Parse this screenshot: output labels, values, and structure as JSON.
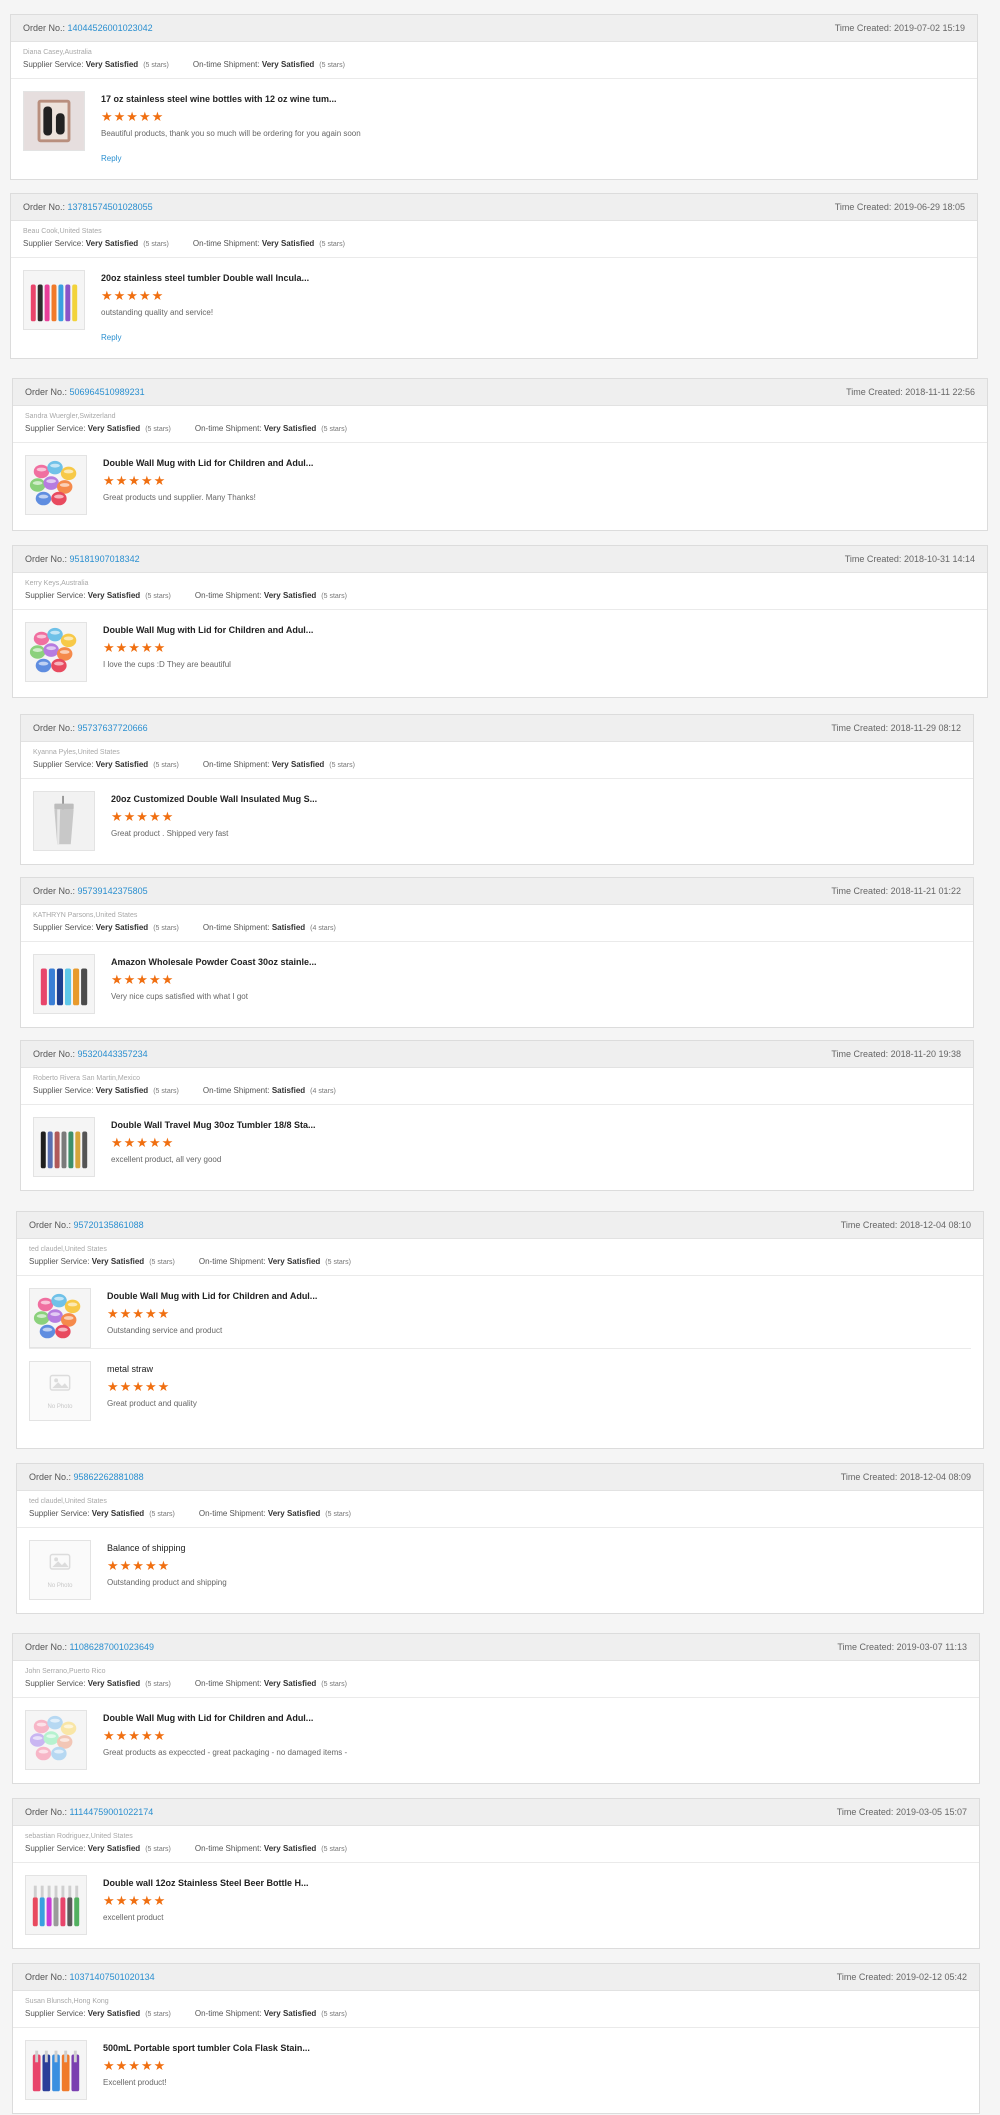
{
  "labels": {
    "order_no": "Order No.:",
    "time_created": "Time Created:",
    "supplier_service": "Supplier Service:",
    "on_time_shipment": "On-time Shipment:",
    "reply": "Reply",
    "no_photo": "No Photo"
  },
  "colors": {
    "link": "#2a8fd0",
    "star": "#f06f11",
    "header_bg": "#efefef"
  },
  "reviews": [
    {
      "order_no": "140445260010230​42",
      "time": "2019-07-02 15:19",
      "buyer": "Diana Casey,Australia",
      "supplier_rating": "Very Satisfied",
      "supplier_stars": "(5 stars)",
      "shipment_rating": "Very Satisfied",
      "shipment_stars": "(5 stars)",
      "items": [
        {
          "title": "17 oz stainless steel wine bottles with 12 oz wine tum...",
          "stars": "★★★★★",
          "comment": "Beautiful products, thank you so much will be ordering for you again soon",
          "image": "wine-bottle-set",
          "reply": "Reply"
        }
      ]
    },
    {
      "order_no": "137815745010280​55",
      "time": "2019-06-29 18:05",
      "buyer": "Beau Cook,United States",
      "supplier_rating": "Very Satisfied",
      "supplier_stars": "(5 stars)",
      "shipment_rating": "Very Satisfied",
      "shipment_stars": "(5 stars)",
      "items": [
        {
          "title": "20oz stainless steel tumbler Double wall Incula...",
          "stars": "★★★★★",
          "comment": "outstanding quality and service!",
          "image": "colored-tumblers",
          "reply": "Reply"
        }
      ]
    },
    {
      "order_no": "5069645109892​31",
      "time": "2018-11-11 22:56",
      "buyer": "Sandra Wuergler,Switzerland",
      "supplier_rating": "Very Satisfied",
      "supplier_stars": "(5 stars)",
      "shipment_rating": "Very Satisfied",
      "shipment_stars": "(5 stars)",
      "items": [
        {
          "title": "Double Wall Mug with Lid for Children and Adul...",
          "stars": "★★★★★",
          "comment": "Great products und supplier. Many Thanks!",
          "image": "colorful-mugs"
        }
      ]
    },
    {
      "order_no": "951819070183​42",
      "time": "2018-10-31 14:14",
      "buyer": "Kerry Keys,Australia",
      "supplier_rating": "Very Satisfied",
      "supplier_stars": "(5 stars)",
      "shipment_rating": "Very Satisfied",
      "shipment_stars": "(5 stars)",
      "items": [
        {
          "title": "Double Wall Mug with Lid for Children and Adul...",
          "stars": "★★★★★",
          "comment": "I love the cups :D They are beautiful",
          "image": "colorful-mugs"
        }
      ]
    },
    {
      "order_no": "957376377206​66",
      "time": "2018-11-29 08:12",
      "buyer": "Kyanna Pyles,United States",
      "supplier_rating": "Very Satisfied",
      "supplier_stars": "(5 stars)",
      "shipment_rating": "Very Satisfied",
      "shipment_stars": "(5 stars)",
      "items": [
        {
          "title": "20oz Customized Double Wall Insulated Mug S...",
          "stars": "★★★★★",
          "comment": "Great product . Shipped very fast",
          "image": "silver-tumbler"
        }
      ]
    },
    {
      "order_no": "957391423758​05",
      "time": "2018-11-21 01:22",
      "buyer": "KATHRYN Parsons,United States",
      "supplier_rating": "Very Satisfied",
      "supplier_stars": "(5 stars)",
      "shipment_rating": "Satisfied",
      "shipment_stars": "(4 stars)",
      "items": [
        {
          "title": "Amazon Wholesale Powder Coast 30oz stainle...",
          "stars": "★★★★★",
          "comment": "Very nice cups satisfied with what I got",
          "image": "powder-tumblers"
        }
      ]
    },
    {
      "order_no": "953204433572​34",
      "time": "2018-11-20 19:38",
      "buyer": "Roberto Rivera San Martin,Mexico",
      "supplier_rating": "Very Satisfied",
      "supplier_stars": "(5 stars)",
      "shipment_rating": "Satisfied",
      "shipment_stars": "(4 stars)",
      "items": [
        {
          "title": "Double Wall Travel Mug 30oz Tumbler 18/8 Sta...",
          "stars": "★★★★★",
          "comment": "excellent product, all very good",
          "image": "travel-mugs"
        }
      ]
    },
    {
      "order_no": "957201358610​88",
      "time": "2018-12-04 08:10",
      "buyer": "ted claudel,United States",
      "supplier_rating": "Very Satisfied",
      "supplier_stars": "(5 stars)",
      "shipment_rating": "Very Satisfied",
      "shipment_stars": "(5 stars)",
      "items": [
        {
          "title": "Double Wall Mug with Lid for Children and Adul...",
          "stars": "★★★★★",
          "comment": "Outstanding service and product",
          "image": "colorful-mugs"
        },
        {
          "title": "metal straw",
          "stars": "★★★★★",
          "comment": "Great product and quality",
          "image": "no-photo",
          "title_weight": "normal"
        }
      ]
    },
    {
      "order_no": "958622628810​88",
      "time": "2018-12-04 08:09",
      "buyer": "ted claudel,United States",
      "supplier_rating": "Very Satisfied",
      "supplier_stars": "(5 stars)",
      "shipment_rating": "Very Satisfied",
      "shipment_stars": "(5 stars)",
      "items": [
        {
          "title": "Balance of shipping",
          "stars": "★★★★★",
          "comment": "Outstanding product and shipping",
          "image": "no-photo",
          "title_weight": "normal"
        }
      ]
    },
    {
      "order_no": "110862870010236​49",
      "time": "2019-03-07 11:13",
      "buyer": "John Serrano,Puerto Rico",
      "supplier_rating": "Very Satisfied",
      "supplier_stars": "(5 stars)",
      "shipment_rating": "Very Satisfied",
      "shipment_stars": "(5 stars)",
      "items": [
        {
          "title": "Double Wall Mug with Lid for Children and Adul...",
          "stars": "★★★★★",
          "comment": "Great products as expeccted - great packaging - no damaged items -",
          "image": "pastel-mugs"
        }
      ]
    },
    {
      "order_no": "111447590010221​74",
      "time": "2019-03-05 15:07",
      "buyer": "sebastian Rodriguez,United States",
      "supplier_rating": "Very Satisfied",
      "supplier_stars": "(5 stars)",
      "shipment_rating": "Very Satisfied",
      "shipment_stars": "(5 stars)",
      "items": [
        {
          "title": "Double wall 12oz Stainless Steel Beer Bottle H...",
          "stars": "★★★★★",
          "comment": "excellent product",
          "image": "beer-bottles"
        }
      ]
    },
    {
      "order_no": "103714075010201​34",
      "time": "2019-02-12 05:42",
      "buyer": "Susan Blunsch,Hong Kong",
      "supplier_rating": "Very Satisfied",
      "supplier_stars": "(5 stars)",
      "shipment_rating": "Very Satisfied",
      "shipment_stars": "(5 stars)",
      "items": [
        {
          "title": "500mL Portable sport tumbler Cola Flask Stain...",
          "stars": "★★★★★",
          "comment": "Excellent product!",
          "image": "cola-flasks"
        }
      ]
    }
  ]
}
